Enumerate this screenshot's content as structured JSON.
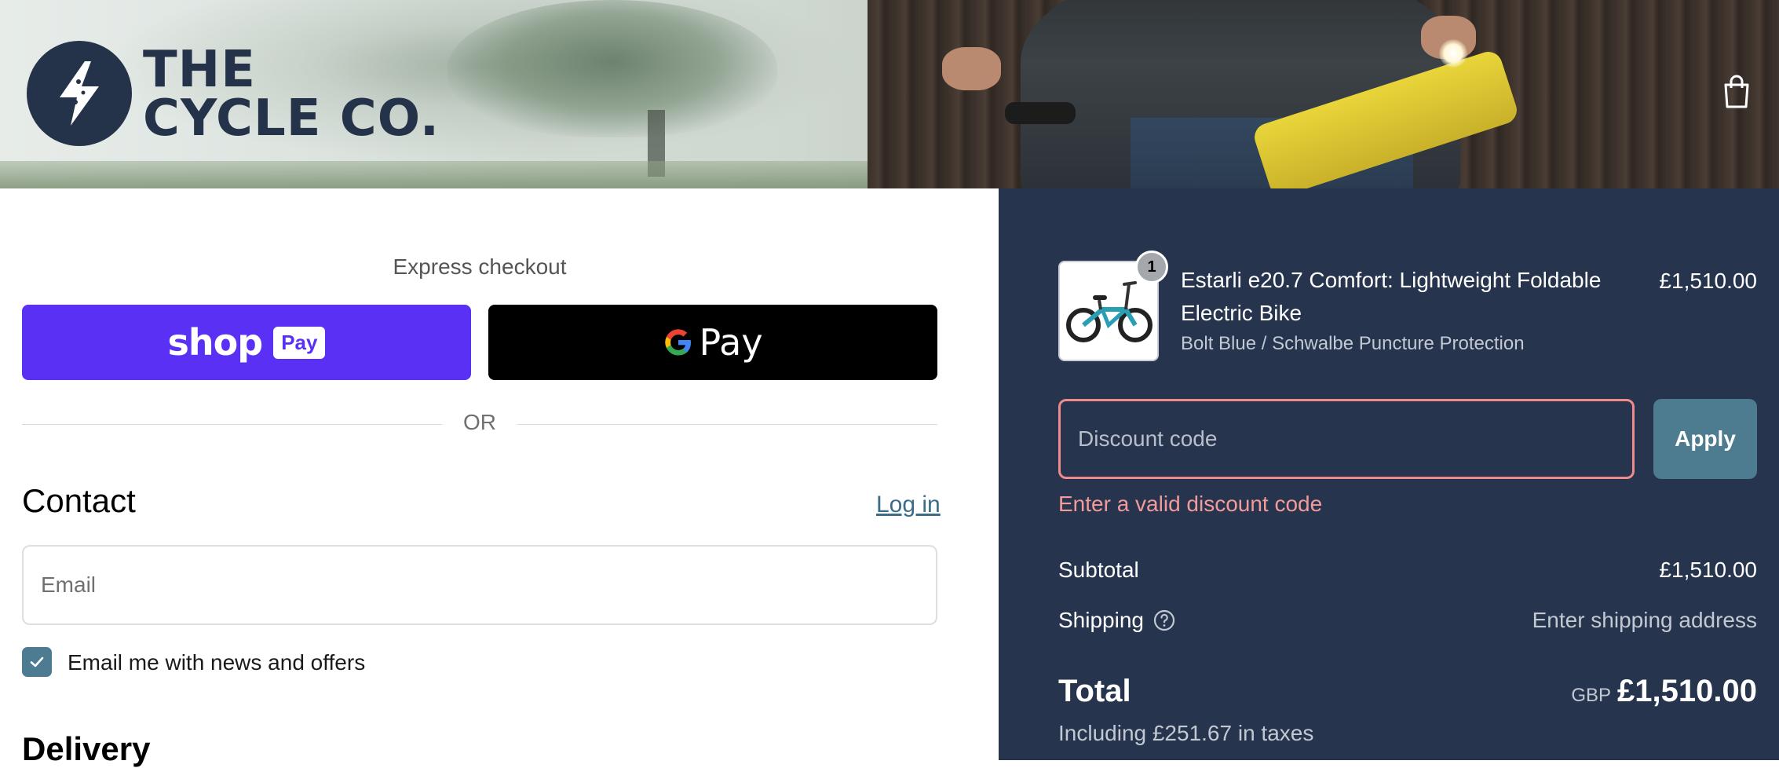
{
  "brand": {
    "line1": "THE",
    "line2": "CYCLE CO."
  },
  "colors": {
    "summary_bg": "#26344d",
    "shop_purple": "#5a31f4",
    "accent_teal": "#4c7b92",
    "error": "#f39a9a",
    "brand_navy": "#243349"
  },
  "express": {
    "title": "Express checkout",
    "shop_word": "shop",
    "shop_pay": "Pay",
    "gpay_word": "Pay",
    "or": "OR"
  },
  "contact": {
    "heading": "Contact",
    "login": "Log in",
    "email_placeholder": "Email",
    "news_label": "Email me with news and offers",
    "news_checked": true
  },
  "delivery": {
    "heading": "Delivery"
  },
  "summary": {
    "item": {
      "quantity": "1",
      "name": "Estarli e20.7 Comfort: Lightweight Foldable Electric Bike",
      "variant": "Bolt Blue / Schwalbe Puncture Protection",
      "price": "£1,510.00"
    },
    "discount": {
      "placeholder": "Discount code",
      "apply": "Apply",
      "error": "Enter a valid discount code"
    },
    "subtotal": {
      "label": "Subtotal",
      "value": "£1,510.00"
    },
    "shipping": {
      "label": "Shipping",
      "value": "Enter shipping address"
    },
    "total": {
      "label": "Total",
      "currency": "GBP",
      "value": "£1,510.00",
      "taxes": "Including £251.67 in taxes"
    }
  },
  "icons": [
    "lightning-logo-icon",
    "shopping-bag-icon",
    "google-g-icon",
    "checkmark-icon",
    "help-circle-icon",
    "bike-thumbnail"
  ]
}
